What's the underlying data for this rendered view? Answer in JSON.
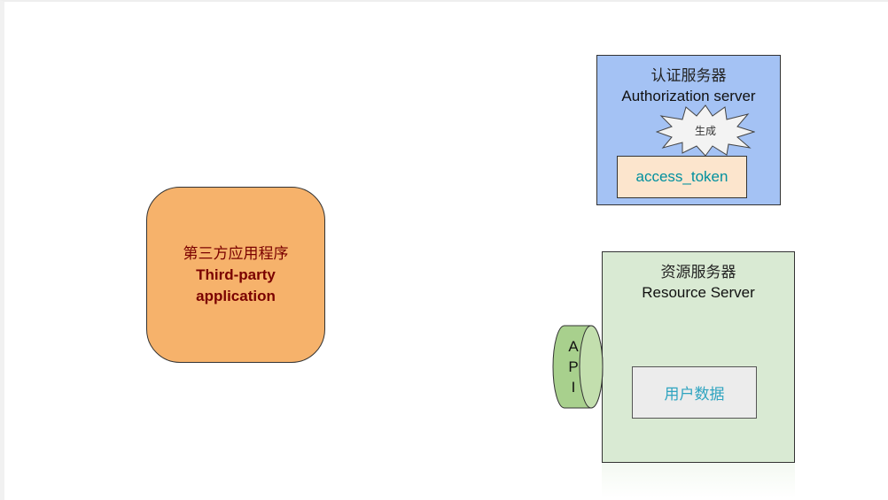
{
  "third_party": {
    "zh": "第三方应用程序",
    "en_line1": "Third-party",
    "en_line2": "application"
  },
  "auth_server": {
    "zh": "认证服务器",
    "en": "Authorization server",
    "burst": "生成",
    "token": "access_token"
  },
  "resource_server": {
    "zh": "资源服务器",
    "en": "Resource Server",
    "user_data": "用户数据"
  },
  "api": {
    "letters": [
      "A",
      "P",
      "I"
    ]
  },
  "colors": {
    "app_fill": "#f6b26b",
    "app_text": "#7a0000",
    "auth_fill": "#a4c2f4",
    "token_fill": "#fce5cd",
    "token_text": "#00909e",
    "resource_fill": "#d9ead3",
    "user_data_fill": "#ececec",
    "user_data_text": "#2fa4c0",
    "api_fill": "#a8d08d"
  }
}
